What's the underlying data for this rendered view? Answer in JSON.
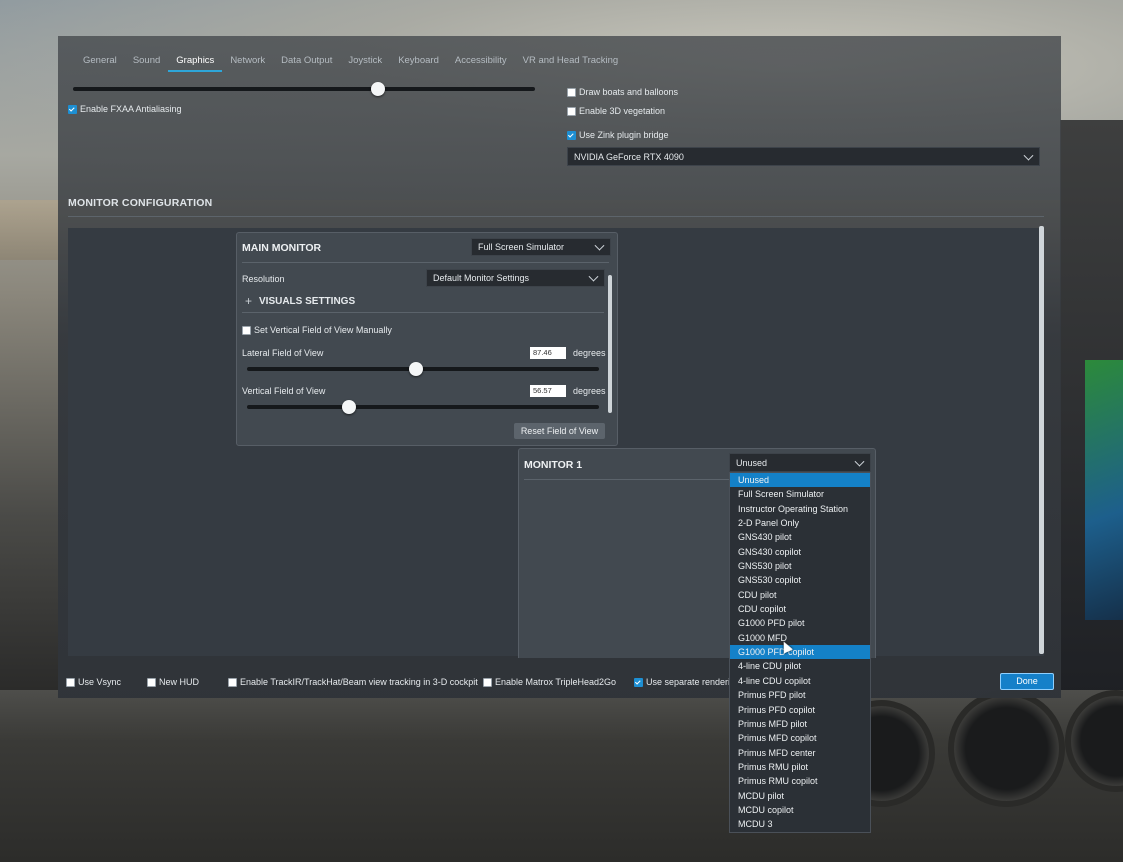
{
  "tabs": [
    "General",
    "Sound",
    "Graphics",
    "Network",
    "Data Output",
    "Joystick",
    "Keyboard",
    "Accessibility",
    "VR and Head Tracking"
  ],
  "active_tab": "Graphics",
  "graphics": {
    "fxaa_label": "Enable FXAA Antialiasing",
    "fxaa_checked": true,
    "top_slider_level": 0.66,
    "boats_label": "Draw boats and balloons",
    "boats_checked": false,
    "vegetation_label": "Enable 3D vegetation",
    "vegetation_checked": false,
    "zink_label": "Use Zink plugin bridge",
    "zink_checked": true,
    "gpu_value": "NVIDIA GeForce RTX 4090"
  },
  "monitor_config": {
    "title": "MONITOR CONFIGURATION",
    "main": {
      "title": "MAIN MONITOR",
      "mode_value": "Full Screen Simulator",
      "resolution_label": "Resolution",
      "resolution_value": "Default Monitor Settings",
      "visuals_title": "VISUALS SETTINGS",
      "visuals_expander": "+",
      "vfov_manual_label": "Set Vertical Field of View Manually",
      "vfov_manual_checked": false,
      "lateral_label": "Lateral Field of View",
      "lateral_value": "87.46",
      "lateral_unit": "degrees",
      "lateral_level": 0.48,
      "vertical_label": "Vertical Field of View",
      "vertical_value": "56.57",
      "vertical_unit": "degrees",
      "vertical_level": 0.29,
      "reset_label": "Reset Field of View"
    },
    "monitor1": {
      "title": "MONITOR 1",
      "mode_value": "Unused",
      "options": [
        "Unused",
        "Full Screen Simulator",
        "Instructor Operating Station",
        "2-D Panel Only",
        "GNS430 pilot",
        "GNS430 copilot",
        "GNS530 pilot",
        "GNS530 copilot",
        "CDU pilot",
        "CDU copilot",
        "G1000 PFD pilot",
        "G1000 MFD",
        "G1000 PFD copilot",
        "4-line CDU pilot",
        "4-line CDU copilot",
        "Primus PFD pilot",
        "Primus PFD copilot",
        "Primus MFD pilot",
        "Primus MFD copilot",
        "Primus MFD center",
        "Primus RMU pilot",
        "Primus RMU copilot",
        "MCDU pilot",
        "MCDU copilot",
        "MCDU 3"
      ],
      "selected_index": 0,
      "hover_index": 12
    }
  },
  "footer": {
    "vsync_label": "Use Vsync",
    "vsync_checked": false,
    "newhud_label": "New HUD",
    "newhud_checked": false,
    "trackir_label": "Enable TrackIR/TrackHat/Beam view tracking in 3-D cockpit",
    "trackir_checked": false,
    "matrox_label": "Enable Matrox TripleHead2Go",
    "matrox_checked": false,
    "separate_label": "Use separate rendering",
    "separate_checked": true,
    "done_label": "Done"
  },
  "colors": {
    "accent": "#1481c8",
    "panel": "#424950",
    "dialog": "#353b42"
  }
}
